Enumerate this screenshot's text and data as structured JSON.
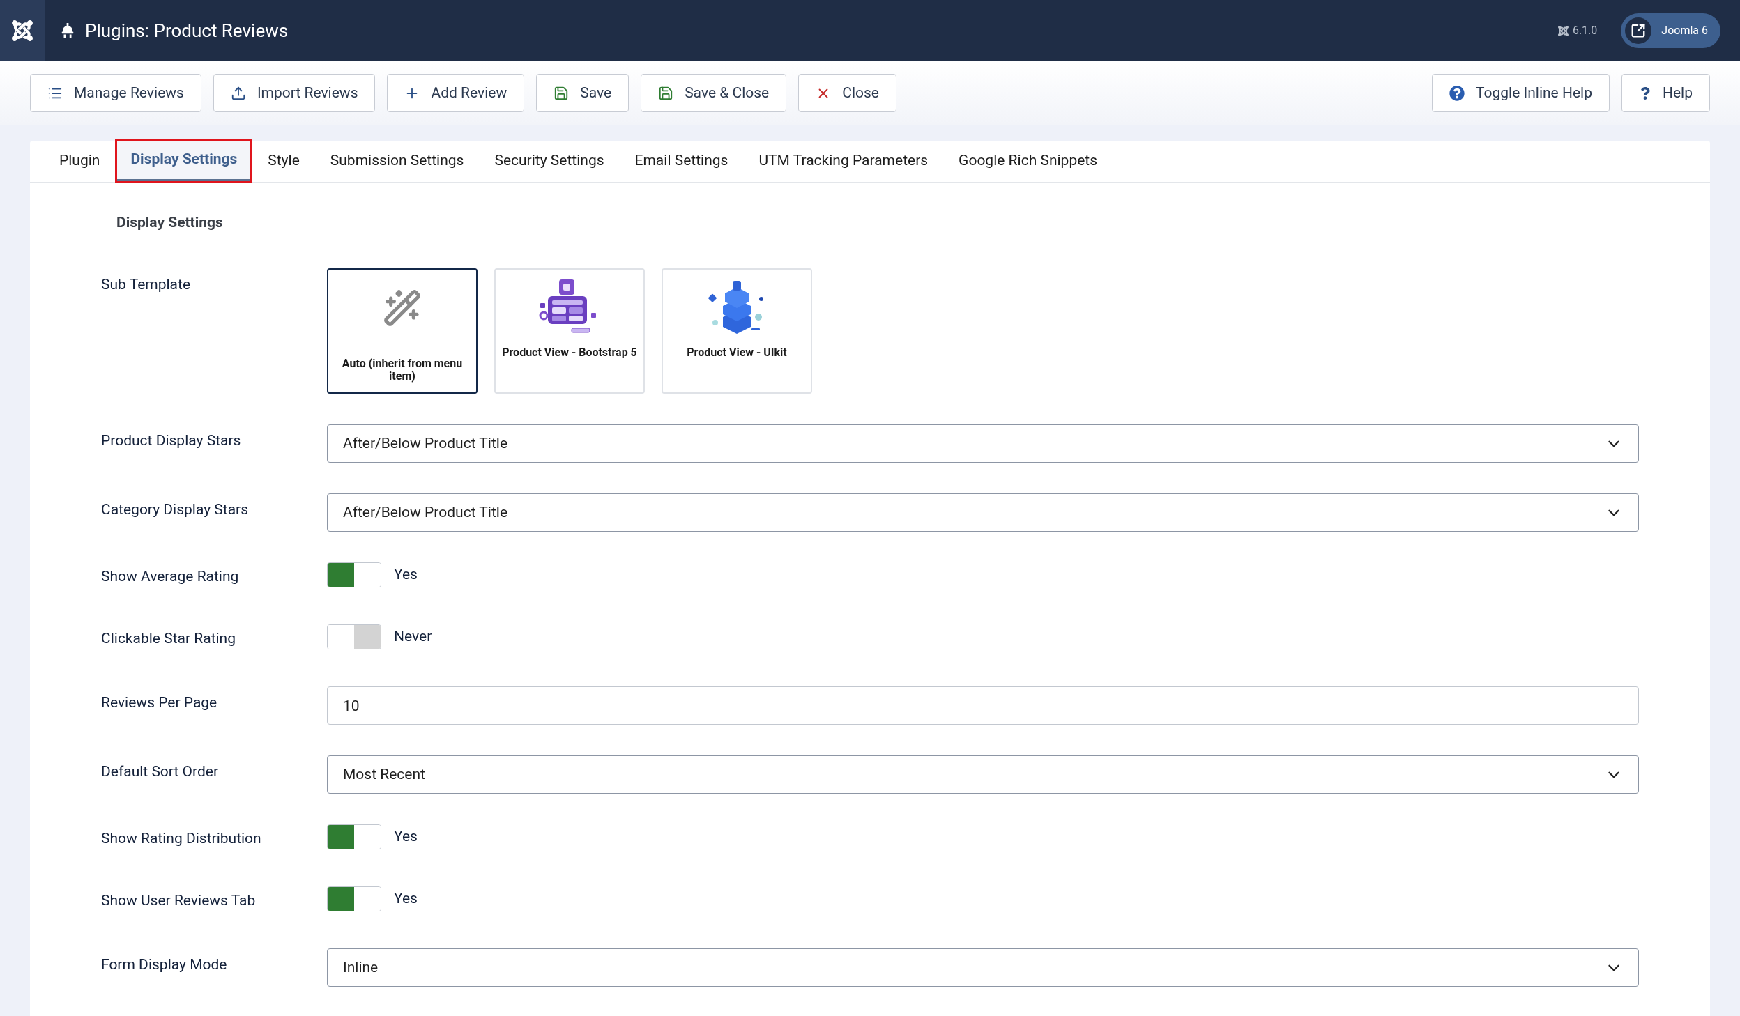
{
  "header": {
    "title": "Plugins: Product Reviews",
    "version": "6.1.0",
    "site_button": "Joomla 6"
  },
  "toolbar": {
    "left": [
      "Manage Reviews",
      "Import Reviews",
      "Add Review",
      "Save",
      "Save & Close",
      "Close"
    ],
    "right": [
      "Toggle Inline Help",
      "Help"
    ]
  },
  "tabs": [
    {
      "label": "Plugin",
      "selected": false
    },
    {
      "label": "Display Settings",
      "selected": true
    },
    {
      "label": "Style",
      "selected": false
    },
    {
      "label": "Submission Settings",
      "selected": false
    },
    {
      "label": "Security Settings",
      "selected": false
    },
    {
      "label": "Email Settings",
      "selected": false
    },
    {
      "label": "UTM Tracking Parameters",
      "selected": false
    },
    {
      "label": "Google Rich Snippets",
      "selected": false
    }
  ],
  "fieldset": {
    "legend": "Display Settings",
    "fields": [
      {
        "kind": "templates",
        "label": "Sub Template",
        "options": [
          {
            "label": "Auto (inherit from menu item)",
            "selected": true
          },
          {
            "label": "Product View - Bootstrap 5",
            "selected": false
          },
          {
            "label": "Product View - UIkit",
            "selected": false
          }
        ]
      },
      {
        "kind": "select",
        "label": "Product Display Stars",
        "value": "After/Below Product Title"
      },
      {
        "kind": "select",
        "label": "Category Display Stars",
        "value": "After/Below Product Title"
      },
      {
        "kind": "toggle",
        "label": "Show Average Rating",
        "on": true,
        "value": "Yes"
      },
      {
        "kind": "toggle",
        "label": "Clickable Star Rating",
        "on": false,
        "value": "Never"
      },
      {
        "kind": "text",
        "label": "Reviews Per Page",
        "value": "10"
      },
      {
        "kind": "select",
        "label": "Default Sort Order",
        "value": "Most Recent"
      },
      {
        "kind": "toggle",
        "label": "Show Rating Distribution",
        "on": true,
        "value": "Yes"
      },
      {
        "kind": "toggle",
        "label": "Show User Reviews Tab",
        "on": true,
        "value": "Yes"
      },
      {
        "kind": "select",
        "label": "Form Display Mode",
        "value": "Inline"
      }
    ]
  }
}
